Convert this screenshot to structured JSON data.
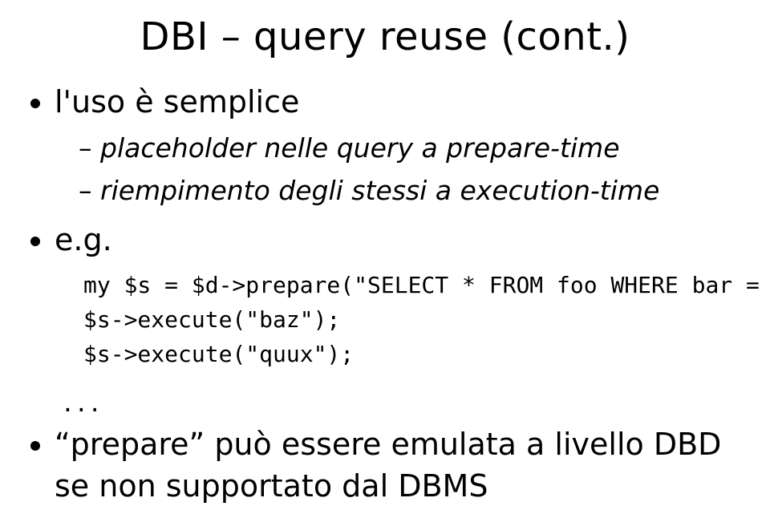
{
  "title": "DBI – query reuse (cont.)",
  "bullets": {
    "first": {
      "text": "l'uso è semplice",
      "sub": [
        "placeholder nelle query a prepare-time",
        "riempimento degli stessi a execution-time"
      ]
    },
    "second": {
      "text": "e.g.",
      "code": [
        "my $s = $d->prepare(\"SELECT * FROM foo WHERE bar = ?\");",
        "$s->execute(\"baz\");",
        "$s->execute(\"quux\");"
      ],
      "dots": "..."
    },
    "third": {
      "text": "“prepare” può essere emulata a livello DBD se non supportato dal DBMS"
    }
  }
}
